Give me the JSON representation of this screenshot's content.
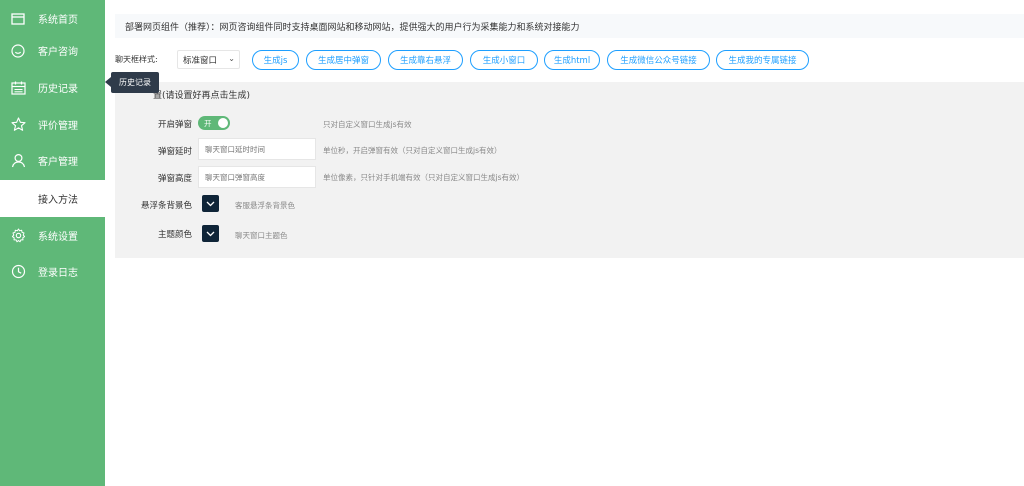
{
  "sidebar": {
    "items": [
      {
        "label": "系统首页",
        "icon": "window-icon"
      },
      {
        "label": "客户咨询",
        "icon": "smile-icon"
      },
      {
        "label": "历史记录",
        "icon": "calendar-icon"
      },
      {
        "label": "评价管理",
        "icon": "star-icon"
      },
      {
        "label": "客户管理",
        "icon": "user-icon"
      },
      {
        "label": "接入方法",
        "icon": ""
      },
      {
        "label": "系统设置",
        "icon": "gear-icon"
      },
      {
        "label": "登录日志",
        "icon": "clock-icon"
      }
    ],
    "active_index": 5
  },
  "tooltip": {
    "text": "历史记录"
  },
  "notice": {
    "text": "部署网页组件（推荐）：网页咨询组件同时支持桌面网站和移动网站，提供强大的用户行为采集能力和系统对接能力"
  },
  "toolbar": {
    "style_label": "聊天框样式:",
    "style_selected": "标准窗口",
    "buttons": [
      "生成js",
      "生成居中弹窗",
      "生成靠右悬浮",
      "生成小窗口",
      "生成html",
      "生成微信公众号链接",
      "生成我的专属链接"
    ]
  },
  "panel": {
    "title": "置(请设置好再点击生成)",
    "popup_toggle": {
      "label": "开启弹窗",
      "state_text": "开",
      "hint": "只对自定义窗口生成js有效"
    },
    "popup_delay": {
      "label": "弹窗延时",
      "placeholder": "聊天窗口延时时间",
      "hint": "单位秒，开启弹窗有效（只对自定义窗口生成js有效）"
    },
    "popup_height": {
      "label": "弹窗高度",
      "placeholder": "聊天窗口弹窗高度",
      "hint": "单位像素，只针对手机端有效（只对自定义窗口生成js有效）"
    },
    "float_bg": {
      "label": "悬浮条背景色",
      "hint": "客服悬浮条背景色",
      "color": "#0f2438"
    },
    "theme_color": {
      "label": "主题颜色",
      "hint": "聊天窗口主题色",
      "color": "#0f2438"
    }
  },
  "colors": {
    "sidebar": "#5fb878",
    "accent": "#1e9fff",
    "panel": "#f2f2f2"
  }
}
